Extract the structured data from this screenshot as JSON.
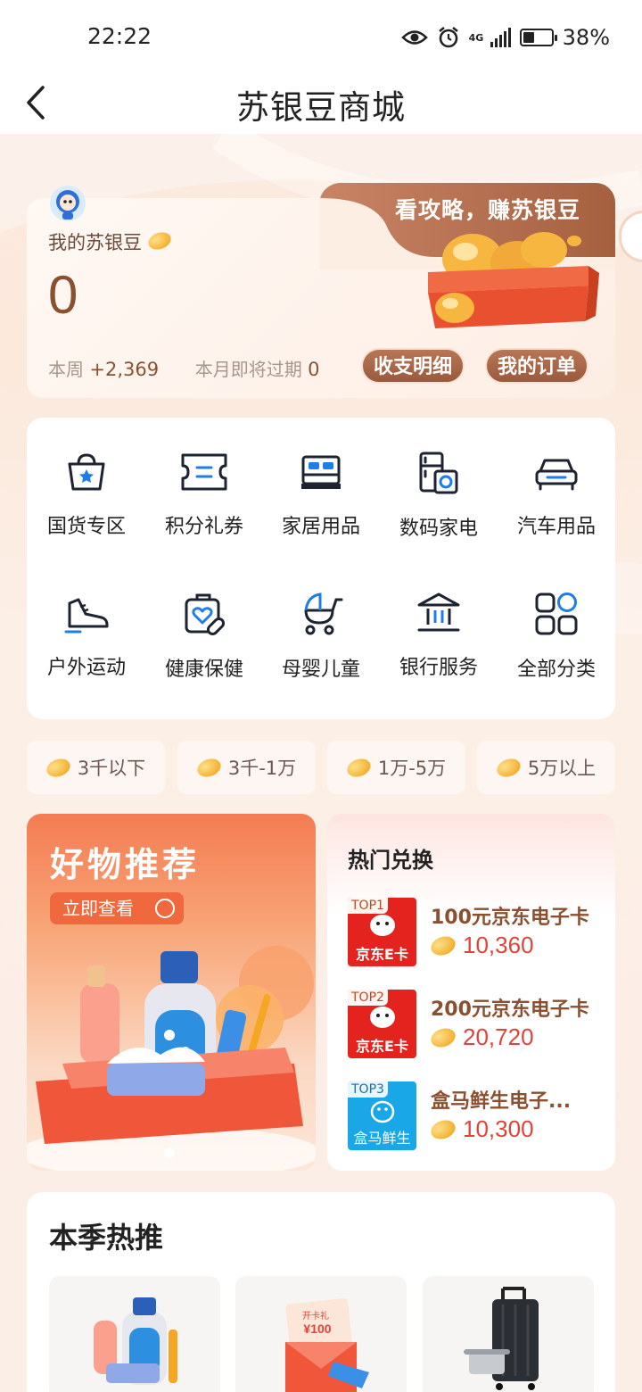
{
  "status": {
    "time": "22:22",
    "network": "4G",
    "battery": "38%"
  },
  "nav": {
    "title": "苏银豆商城"
  },
  "balance": {
    "label": "我的苏银豆",
    "value": "0",
    "week_label": "本周",
    "week_value": "+2,369",
    "expire_label": "本月即将过期",
    "expire_value": "0",
    "promo": "看攻略，赚苏银豆",
    "btn_detail": "收支明细",
    "btn_orders": "我的订单"
  },
  "categories": [
    {
      "label": "国货专区",
      "icon": "shopping-bag-icon"
    },
    {
      "label": "积分礼券",
      "icon": "coupon-icon"
    },
    {
      "label": "家居用品",
      "icon": "bed-icon"
    },
    {
      "label": "数码家电",
      "icon": "appliance-icon"
    },
    {
      "label": "汽车用品",
      "icon": "car-icon"
    },
    {
      "label": "户外运动",
      "icon": "sneaker-icon"
    },
    {
      "label": "健康保健",
      "icon": "health-kit-icon"
    },
    {
      "label": "母婴儿童",
      "icon": "stroller-icon"
    },
    {
      "label": "银行服务",
      "icon": "bank-icon"
    },
    {
      "label": "全部分类",
      "icon": "grid-icon"
    }
  ],
  "price_filters": [
    "3千以下",
    "3千-1万",
    "1万-5万",
    "5万以上"
  ],
  "recommend": {
    "title": "好物推荐",
    "button": "立即查看"
  },
  "hot": {
    "title": "热门兑换",
    "items": [
      {
        "rank": "TOP1",
        "name": "100元京东电子卡",
        "price": "10,360",
        "brand": "京东E卡"
      },
      {
        "rank": "TOP2",
        "name": "200元京东电子卡",
        "price": "20,720",
        "brand": "京东E卡"
      },
      {
        "rank": "TOP3",
        "name": "盒马鲜生电子...",
        "price": "10,300",
        "brand": "盒马鲜生"
      }
    ]
  },
  "season": {
    "title": "本季热推",
    "gift_label": "开卡礼",
    "gift_value": "¥100"
  },
  "colors": {
    "accent": "#8a5030",
    "price": "#e0433a",
    "icon_blue": "#1f7de8",
    "icon_dark": "#1d2330"
  }
}
